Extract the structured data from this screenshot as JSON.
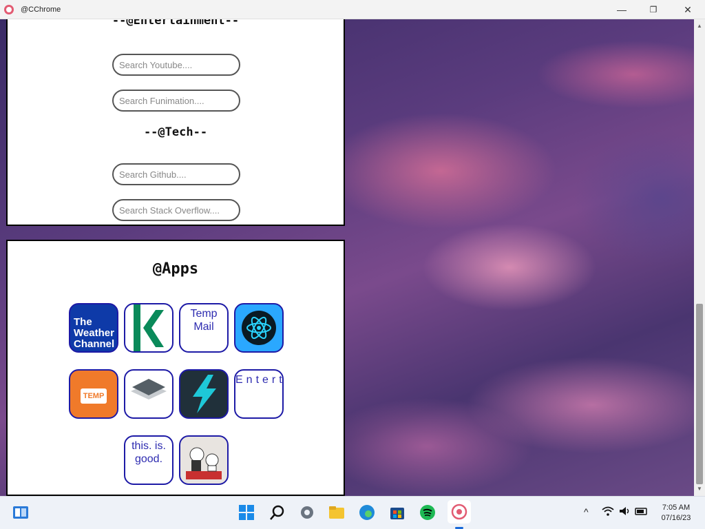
{
  "window": {
    "title": "@CChrome",
    "minimize": "—",
    "maximize": "❐",
    "close": "✕"
  },
  "sections": {
    "entertainment": {
      "heading": "--@Entertainment--",
      "youtube_placeholder": "Search Youtube....",
      "funimation_placeholder": "Search Funimation...."
    },
    "tech": {
      "heading": "--@Tech--",
      "github_placeholder": "Search Github....",
      "stackoverflow_placeholder": "Search Stack Overflow...."
    },
    "apps": {
      "heading": "@Apps",
      "tiles": [
        {
          "name": "weather-channel",
          "text": "The Weather Channel",
          "color": "#0e3aa8"
        },
        {
          "name": "kahoot-k",
          "text": "",
          "color": "#0a8a5a"
        },
        {
          "name": "temp-mail",
          "alt": "Temp Mail"
        },
        {
          "name": "react",
          "text": "",
          "color": "#2aa8ff"
        },
        {
          "name": "temp-number",
          "text": "TEMP",
          "color": "#f07a2a"
        },
        {
          "name": "layers",
          "text": "",
          "color": "#555f66"
        },
        {
          "name": "bolt",
          "text": "",
          "color": "#1ec8d8"
        },
        {
          "name": "entertainment",
          "alt": "Entertainment"
        },
        {
          "name": "this-is-good",
          "alt": "this. is. good."
        },
        {
          "name": "cats",
          "text": "",
          "color": "#c83030"
        }
      ]
    }
  },
  "taskbar": {
    "time": "7:05 AM",
    "date": "07/16/23"
  }
}
